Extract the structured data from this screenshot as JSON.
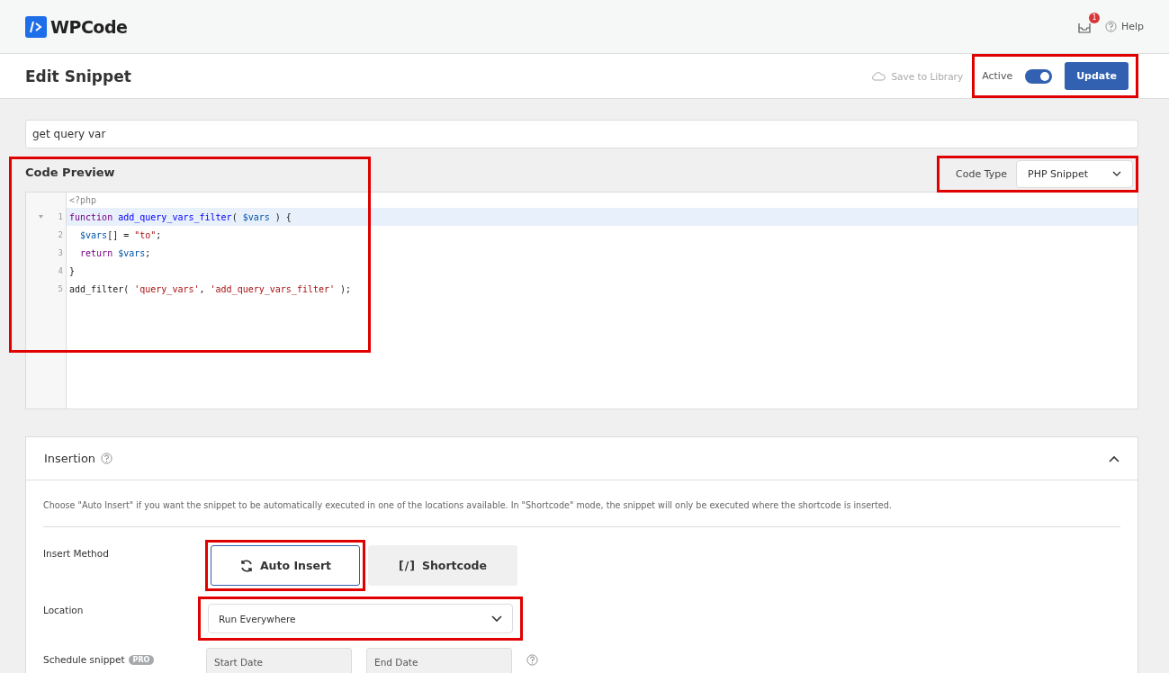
{
  "header": {
    "logo_text": "WPCode",
    "notification_count": "1",
    "help": "Help"
  },
  "title_bar": {
    "title": "Edit Snippet",
    "save_to_library": "Save to Library",
    "active_label": "Active",
    "active": true,
    "update": "Update"
  },
  "snippet_title": {
    "value": "get query var"
  },
  "code_preview": {
    "title": "Code Preview",
    "code_type_label": "Code Type",
    "code_type": "PHP Snippet",
    "header_line": "<?php",
    "lines": [
      {
        "number": "1",
        "active": true,
        "foldable": true,
        "tokens": [
          {
            "kind": "keyword",
            "text": "function"
          },
          {
            "kind": "def",
            "text": " add_query_vars_filter"
          },
          {
            "kind": "plain",
            "text": "( "
          },
          {
            "kind": "variable",
            "text": "$vars"
          },
          {
            "kind": "plain",
            "text": " ) {"
          }
        ]
      },
      {
        "number": "2",
        "active": false,
        "foldable": false,
        "tokens": [
          {
            "kind": "variable",
            "text": "  $vars"
          },
          {
            "kind": "plain",
            "text": "[] = "
          },
          {
            "kind": "string",
            "text": "\"to\""
          },
          {
            "kind": "plain",
            "text": ";"
          }
        ]
      },
      {
        "number": "3",
        "active": false,
        "foldable": false,
        "tokens": [
          {
            "kind": "keyword",
            "text": "  return"
          },
          {
            "kind": "variable",
            "text": " $vars"
          },
          {
            "kind": "plain",
            "text": ";"
          }
        ]
      },
      {
        "number": "4",
        "active": false,
        "foldable": false,
        "tokens": [
          {
            "kind": "plain",
            "text": "}"
          }
        ]
      },
      {
        "number": "5",
        "active": false,
        "foldable": false,
        "tokens": [
          {
            "kind": "plain",
            "text": "add_filter( "
          },
          {
            "kind": "string",
            "text": "'query_vars'"
          },
          {
            "kind": "plain",
            "text": ", "
          },
          {
            "kind": "string",
            "text": "'add_query_vars_filter'"
          },
          {
            "kind": "plain",
            "text": " );"
          }
        ]
      }
    ]
  },
  "insertion": {
    "title": "Insertion",
    "expanded": true,
    "description": "Choose \"Auto Insert\" if you want the snippet to be automatically executed in one of the locations available. In \"Shortcode\" mode, the snippet will only be executed where the shortcode is inserted.",
    "insert_method_label": "Insert Method",
    "methods": [
      {
        "kind": "auto",
        "label": "Auto Insert",
        "selected": true
      },
      {
        "kind": "glyph",
        "glyph": "[/]",
        "label": "Shortcode",
        "selected": false
      }
    ],
    "location_label": "Location",
    "location": "Run Everywhere",
    "schedule_label": "Schedule snippet",
    "schedule_badge": "PRO",
    "start_placeholder": "Start Date",
    "end_placeholder": "End Date"
  }
}
